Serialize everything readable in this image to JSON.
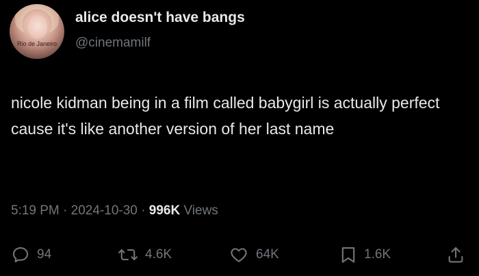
{
  "author": {
    "display_name": "alice doesn't have bangs",
    "handle": "@cinemamilf",
    "avatar_caption": "Rio de Janeiro"
  },
  "tweet": {
    "text": "nicole kidman being in a film called babygirl is actually perfect cause it's like another version of her last name"
  },
  "meta": {
    "time": "5:19 PM",
    "separator": "·",
    "date": "2024-10-30",
    "views_count": "996K",
    "views_label": "Views"
  },
  "actions": {
    "replies": "94",
    "reposts": "4.6K",
    "likes": "64K",
    "bookmarks": "1.6K"
  },
  "colors": {
    "background": "#000000",
    "primary_text": "#e7e9ea",
    "secondary_text": "#71767b"
  }
}
